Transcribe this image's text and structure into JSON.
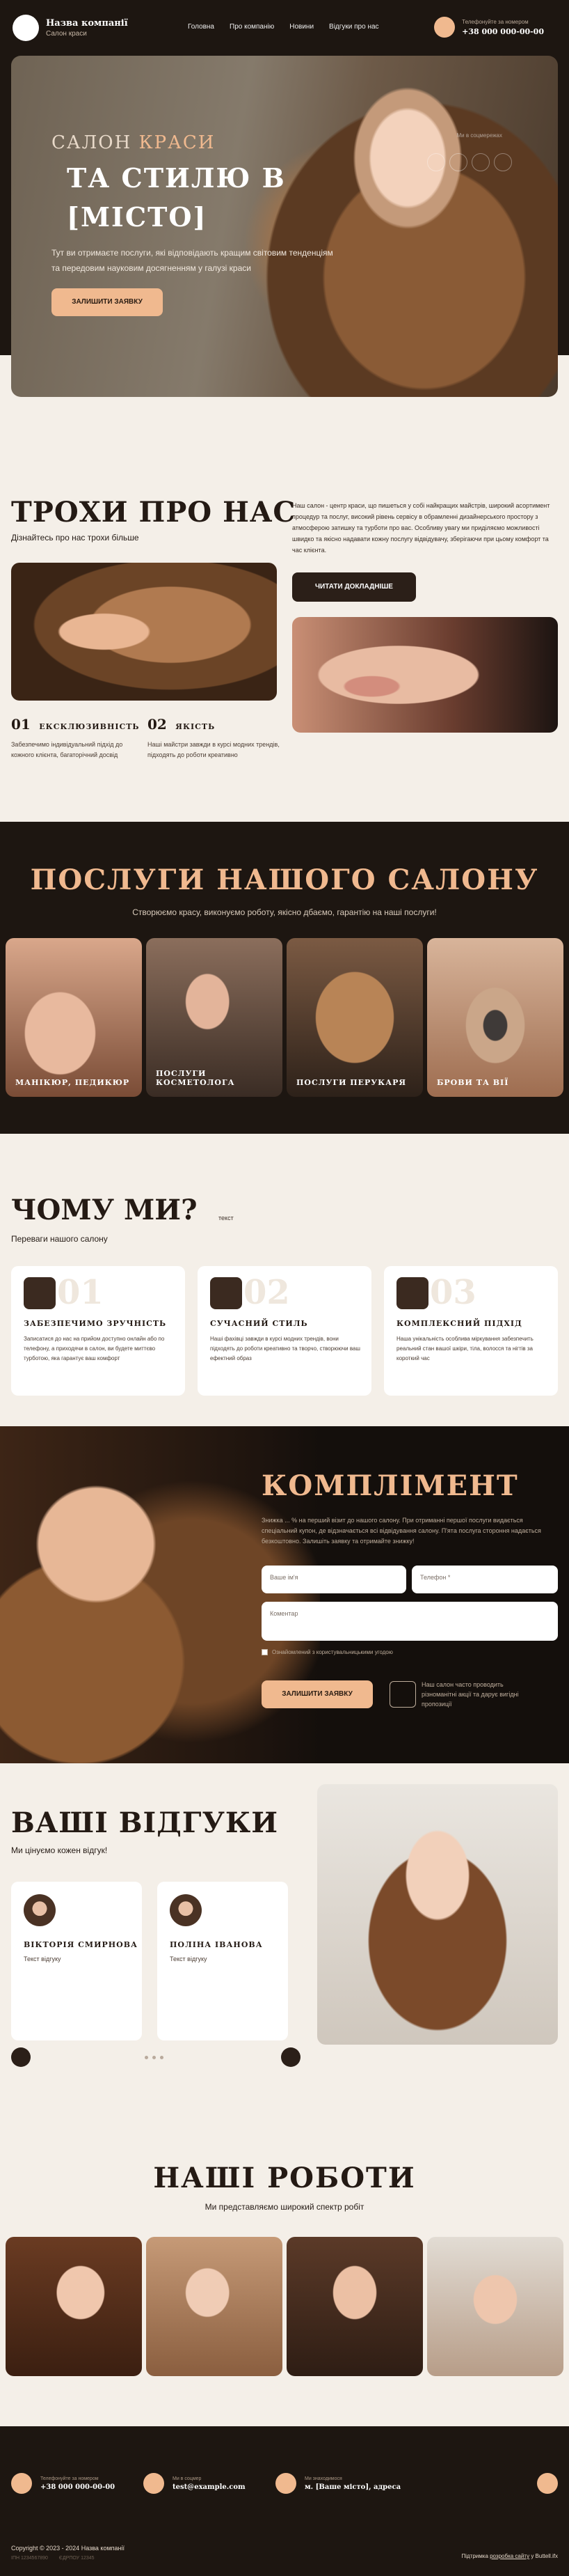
{
  "header": {
    "company": "Назва компанії",
    "tagline": "Салон краси",
    "nav": [
      "Головна",
      "Про компанію",
      "Новини",
      "Відгуки про нас"
    ],
    "phone_label": "Телефонуйте за номером",
    "phone": "+38 000 000-00-00"
  },
  "hero": {
    "subtitle_a": "САЛОН ",
    "subtitle_b": "КРАСИ",
    "title": "ТА СТИЛЮ В [МІСТО]",
    "description": "Тут ви отримаєте послуги, які відповідають кращим світовим тенденціям та передовим науковим досягненням у галузі краси",
    "cta": "ЗАЛИШИТИ ЗАЯВКУ",
    "social_label": "Ми в соцмережах"
  },
  "about": {
    "title": "ТРОХИ ПРО НАС",
    "subtitle": "Дізнайтесь про нас трохи більше",
    "text": "Наш салон - центр краси, що пишеться у собі найкращих майстрів, широкий асортимент процедур та послуг, високий рівень сервісу в обрамленні дизайнерського простору з атмосферою затишку та турботи про вас. Особливу увагу ми приділяємо можливості швидко та якісно надавати кожну послугу відвідувачу, зберігаючи при цьому комфорт та час клієнта.",
    "button": "ЧИТАТИ ДОКЛАДНІШЕ",
    "features": [
      {
        "num": "01",
        "name": "ЕКСКЛЮЗИВНІСТЬ",
        "desc": "Забезпечимо індивідуальний підхід до кожного клієнта, багаторічний досвід"
      },
      {
        "num": "02",
        "name": "ЯКІСТЬ",
        "desc": "Наші майстри завжди в курсі модних трендів, підходять до роботи креативно"
      }
    ]
  },
  "services": {
    "title": "ПОСЛУГИ НАШОГО САЛОНУ",
    "subtitle": "Створюємо красу, виконуємо роботу, якісно дбаємо, гарантію на наші послуги!",
    "items": [
      "МАНІКЮР, ПЕДИКЮР",
      "ПОСЛУГИ КОСМЕТОЛОГА",
      "ПОСЛУГИ ПЕРУКАРЯ",
      "БРОВИ ТА ВІЇ"
    ]
  },
  "why": {
    "title": "ЧОМУ МИ?",
    "tag": "текст",
    "subtitle": "Переваги нашого салону",
    "cards": [
      {
        "num": "01",
        "name": "ЗАБЕЗПЕЧИМО ЗРУЧНІСТЬ",
        "desc": "Записатися до нас на прийом доступно онлайн або по телефону, а приходячи в салон, ви будете миттєво турботою, яка гарантує ваш комфорт"
      },
      {
        "num": "02",
        "name": "СУЧАСНИЙ СТИЛЬ",
        "desc": "Наші фахівці завжди в курсі модних трендів, вони підходять до роботи креативно та творчо, створюючи ваш ефектний образ"
      },
      {
        "num": "03",
        "name": "КОМПЛЕКСНИЙ ПІДХІД",
        "desc": "Наша унікальність особлива міркування забезпечить реальний стан вашої шкіри, тіла, волосся та нігтів за короткий час"
      }
    ]
  },
  "compliment": {
    "title": "КОМПЛІМЕНТ",
    "description": "Знижка ... % на перший візит до нашого салону. При отриманні першої послуги видається спеціальний купон, де відзначається всі відвідування салону. П'ята послуга стороння надається безкоштовно. Залишіть заявку та отримайте знижку!",
    "name_placeholder": "Ваше ім'я",
    "phone_placeholder": "Телефон *",
    "comment_placeholder": "Коментар",
    "consent": "Ознайомлений з користувальницькими угодою",
    "button": "ЗАЛИШИТИ ЗАЯВКУ",
    "note": "Наш салон часто проводить різноманітні акції та дарує вигідні пропозиції"
  },
  "reviews": {
    "title": "ВАШІ ВІДГУКИ",
    "subtitle": "Ми цінуємо кожен відгук!",
    "items": [
      {
        "name": "ВІКТОРІЯ СМИРНОВА",
        "text": "Текст відгуку"
      },
      {
        "name": "ПОЛІНА ІВАНОВА",
        "text": "Текст відгуку"
      }
    ]
  },
  "works": {
    "title": "НАШІ РОБОТИ",
    "subtitle": "Ми представляємо широкий спектр робіт"
  },
  "footer": {
    "phone_label": "Телефонуйте за номером",
    "phone": "+38 000 000-00-00",
    "email_label": "Ми в соцмер",
    "email": "test@example.com",
    "address_label": "Ми знаходимося",
    "address": "м. [Ваше місто], адреса",
    "copyright": "Copyright © 2023 - 2024 Назва компанії",
    "legal_a": "ІПН 1234567890",
    "legal_b": "ЄДРПОУ 12345",
    "dev_a": "Підтримка ",
    "dev_link": "розробка сайту",
    "dev_b": " у Buttell.ifx"
  }
}
